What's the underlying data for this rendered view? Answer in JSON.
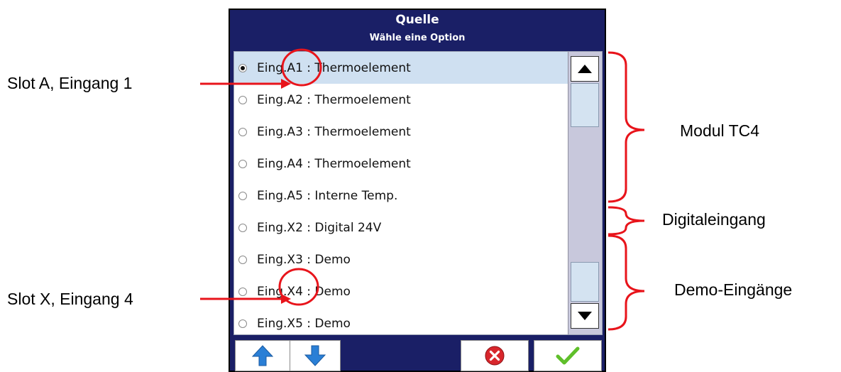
{
  "dialog": {
    "title": "Quelle",
    "subtitle": "Wähle eine Option"
  },
  "options": [
    {
      "label": "Eing.A1 : Thermoelement",
      "selected": true
    },
    {
      "label": "Eing.A2 : Thermoelement",
      "selected": false
    },
    {
      "label": "Eing.A3 : Thermoelement",
      "selected": false
    },
    {
      "label": "Eing.A4 : Thermoelement",
      "selected": false
    },
    {
      "label": "Eing.A5 : Interne Temp.",
      "selected": false
    },
    {
      "label": "Eing.X2 : Digital 24V",
      "selected": false
    },
    {
      "label": "Eing.X3 : Demo",
      "selected": false
    },
    {
      "label": "Eing.X4 : Demo",
      "selected": false
    },
    {
      "label": "Eing.X5 : Demo",
      "selected": false
    }
  ],
  "scrollbar": {
    "up_icon": "triangle-up-icon",
    "down_icon": "triangle-down-icon"
  },
  "toolbar": {
    "buttons": [
      {
        "name": "move-up-button",
        "icon": "blue-arrow-up-icon"
      },
      {
        "name": "move-down-button",
        "icon": "blue-arrow-down-icon"
      },
      {
        "name": "cancel-button",
        "icon": "red-x-circle-icon"
      },
      {
        "name": "confirm-button",
        "icon": "green-check-icon"
      }
    ]
  },
  "annotations": {
    "slot_a": "Slot A, Eingang 1",
    "slot_x": "Slot X, Eingang 4",
    "modul": "Modul TC4",
    "digital": "Digitaleingang",
    "demo": "Demo-Eingänge"
  },
  "colors": {
    "frame": "#1a1f66",
    "selected_row": "#cfe0f1",
    "annotation": "#e8141b",
    "scroll_track": "#c8c8dc",
    "arrow_blue": "#2a7fd6",
    "cancel_red": "#d8262c",
    "confirm_green": "#5fbf2a"
  }
}
